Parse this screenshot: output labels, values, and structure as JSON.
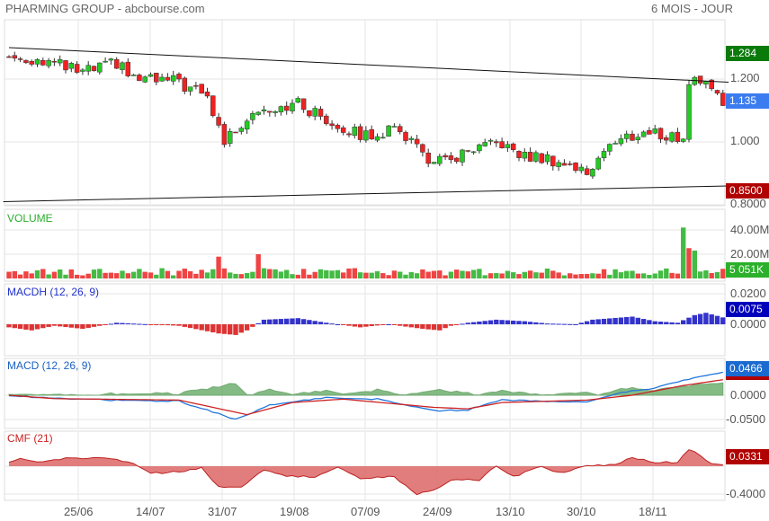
{
  "header": {
    "title": "PHARMING GROUP - abcbourse.com",
    "period": "6 MOIS - JOUR"
  },
  "chart_data": [
    {
      "type": "candlestick",
      "name": "price",
      "y_ticks": [
        "1.200",
        "1.000",
        "0.8000"
      ],
      "ylim": [
        0.8,
        1.3
      ],
      "last_labels": {
        "high": "1.284",
        "last": "1.135",
        "low": "0.8500"
      },
      "colors": {
        "high": "#0a7a0a",
        "last": "#3b7cf0",
        "low": "#b00000",
        "up": "#22cc22",
        "down": "#ee2222"
      },
      "close_keypoints": [
        [
          0,
          1.27
        ],
        [
          6,
          1.26
        ],
        [
          13,
          1.22
        ],
        [
          19,
          1.25
        ],
        [
          22,
          1.2
        ],
        [
          30,
          1.19
        ],
        [
          35,
          1.14
        ],
        [
          38,
          1.0
        ],
        [
          43,
          1.1
        ],
        [
          46,
          1.11
        ],
        [
          51,
          1.12
        ],
        [
          56,
          1.07
        ],
        [
          62,
          1.02
        ],
        [
          69,
          1.04
        ],
        [
          75,
          0.93
        ],
        [
          81,
          0.96
        ],
        [
          87,
          1.0
        ],
        [
          89,
          0.96
        ],
        [
          97,
          0.94
        ],
        [
          102,
          0.9
        ],
        [
          105,
          0.98
        ],
        [
          110,
          1.02
        ],
        [
          113,
          1.03
        ],
        [
          119,
          1.01
        ],
        [
          120,
          1.19
        ],
        [
          123,
          1.2
        ],
        [
          126,
          1.135
        ]
      ],
      "trendlines": [
        {
          "from": [
            0,
            1.3
          ],
          "to": [
            127,
            1.19
          ]
        },
        {
          "from": [
            -1,
            0.81
          ],
          "to": [
            127,
            0.86
          ]
        }
      ]
    },
    {
      "type": "bar",
      "name": "volume",
      "title": "VOLUME",
      "y_ticks": [
        "40.00M",
        "20.00M"
      ],
      "last_label": "5 051K",
      "unit": "M",
      "spikes": [
        [
          37,
          18
        ],
        [
          44,
          20
        ],
        [
          119,
          42
        ],
        [
          120,
          25
        ],
        [
          121,
          23
        ]
      ]
    },
    {
      "type": "bar",
      "name": "macdh",
      "title": "MACDH (12, 26, 9)",
      "y_ticks": [
        "0.0200",
        "0.0000"
      ],
      "last_label": "0.0075",
      "keypoints": [
        [
          0,
          -0.002
        ],
        [
          4,
          -0.004
        ],
        [
          8,
          -0.001
        ],
        [
          13,
          -0.003
        ],
        [
          19,
          0.001
        ],
        [
          30,
          -0.001
        ],
        [
          37,
          -0.006
        ],
        [
          40,
          -0.007
        ],
        [
          42,
          -0.004
        ],
        [
          45,
          0.003
        ],
        [
          51,
          0.004
        ],
        [
          56,
          0.001
        ],
        [
          62,
          -0.002
        ],
        [
          67,
          0
        ],
        [
          73,
          -0.003
        ],
        [
          76,
          -0.004
        ],
        [
          78,
          -0.001
        ],
        [
          81,
          0.001
        ],
        [
          86,
          0.003
        ],
        [
          91,
          0.002
        ],
        [
          95,
          0.0005
        ],
        [
          100,
          0
        ],
        [
          103,
          0.003
        ],
        [
          110,
          0.005
        ],
        [
          114,
          0.002
        ],
        [
          118,
          0.001
        ],
        [
          121,
          0.006
        ],
        [
          123,
          0.0075
        ],
        [
          126,
          0.0045
        ]
      ]
    },
    {
      "type": "line",
      "name": "macd",
      "title": "MACD (12, 26, 9)",
      "y_ticks": [
        "0.0000",
        "-0.0500"
      ],
      "last_label": "0.0466",
      "macd": [
        [
          0,
          0
        ],
        [
          8,
          -0.007
        ],
        [
          18,
          -0.01
        ],
        [
          30,
          -0.012
        ],
        [
          40,
          -0.05
        ],
        [
          46,
          -0.02
        ],
        [
          56,
          -0.005
        ],
        [
          65,
          -0.008
        ],
        [
          75,
          -0.032
        ],
        [
          81,
          -0.03
        ],
        [
          87,
          -0.01
        ],
        [
          97,
          -0.012
        ],
        [
          102,
          -0.015
        ],
        [
          108,
          0.005
        ],
        [
          114,
          0.015
        ],
        [
          122,
          0.04
        ],
        [
          126,
          0.0466
        ]
      ],
      "signal": [
        [
          0,
          0
        ],
        [
          8,
          -0.007
        ],
        [
          30,
          -0.01
        ],
        [
          42,
          -0.04
        ],
        [
          50,
          -0.015
        ],
        [
          59,
          -0.008
        ],
        [
          75,
          -0.025
        ],
        [
          81,
          -0.028
        ],
        [
          87,
          -0.015
        ],
        [
          102,
          -0.01
        ],
        [
          110,
          0
        ],
        [
          119,
          0.02
        ],
        [
          126,
          0.032
        ]
      ]
    },
    {
      "type": "area",
      "name": "cmf",
      "title": "CMF (21)",
      "y_ticks": [
        "-0.4000"
      ],
      "last_label": "0.0331",
      "keypoints": [
        [
          0,
          0.05
        ],
        [
          2,
          0.1
        ],
        [
          5,
          0.05
        ],
        [
          11,
          0.12
        ],
        [
          18,
          0.11
        ],
        [
          22,
          0.05
        ],
        [
          25,
          -0.1
        ],
        [
          30,
          -0.08
        ],
        [
          34,
          -0.02
        ],
        [
          37,
          -0.3
        ],
        [
          41,
          -0.3
        ],
        [
          45,
          -0.05
        ],
        [
          49,
          -0.15
        ],
        [
          54,
          -0.15
        ],
        [
          58,
          0
        ],
        [
          62,
          -0.18
        ],
        [
          68,
          -0.15
        ],
        [
          72,
          -0.4
        ],
        [
          75,
          -0.35
        ],
        [
          78,
          -0.2
        ],
        [
          83,
          -0.2
        ],
        [
          86,
          0
        ],
        [
          89,
          -0.15
        ],
        [
          94,
          0
        ],
        [
          97,
          -0.1
        ],
        [
          102,
          0
        ],
        [
          107,
          0.03
        ],
        [
          110,
          0.12
        ],
        [
          114,
          0.06
        ],
        [
          118,
          0.05
        ],
        [
          120,
          0.25
        ],
        [
          124,
          0.03
        ],
        [
          126,
          0.03
        ]
      ]
    }
  ],
  "x_axis": {
    "labels": [
      "25/06",
      "14/07",
      "31/07",
      "19/08",
      "07/09",
      "24/09",
      "13/10",
      "30/10",
      "18/11"
    ]
  }
}
